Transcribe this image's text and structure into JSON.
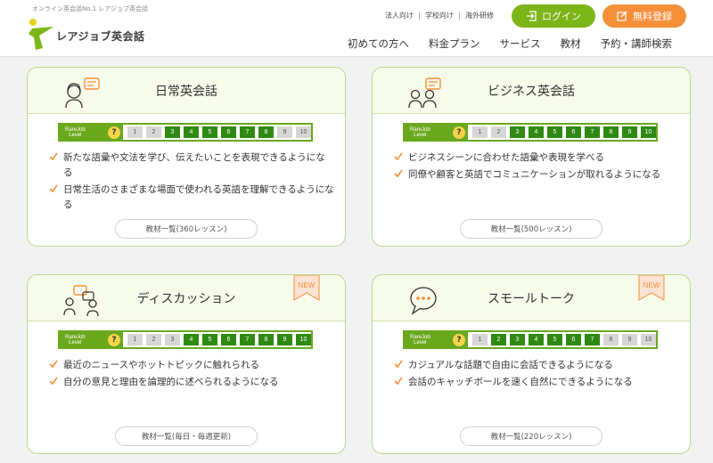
{
  "header": {
    "tagline": "オンライン英会話No.1 レアジョブ英会話",
    "logo_text": "レアジョブ英会話",
    "util_links": [
      "法人向け",
      "学校向け",
      "海外研修"
    ],
    "login_label": "ログイン",
    "signup_label": "無料登録",
    "nav": [
      "初めての方へ",
      "料金プラン",
      "サービス",
      "教材",
      "予約・講師検索"
    ]
  },
  "level_label": [
    "RareJob",
    "Level"
  ],
  "level_help": "?",
  "colors": {
    "accent": "#7cb518",
    "level_on": "#2f8a12",
    "level_off": "#d6d6d6",
    "signup": "#f58f3a"
  },
  "courses": [
    {
      "title": "日常英会話",
      "icon": "woman-speech-icon",
      "new": false,
      "level_range": [
        3,
        8
      ],
      "levels": [
        "1",
        "2",
        "3",
        "4",
        "5",
        "6",
        "7",
        "8",
        "9",
        "10"
      ],
      "bullets": [
        "新たな語彙や文法を学び、伝えたいことを表現できるようになる",
        "日常生活のさまざまな場面で使われる英語を理解できるようになる"
      ],
      "materials_label": "教材一覧(360レッスン)"
    },
    {
      "title": "ビジネス英会話",
      "icon": "business-people-icon",
      "new": false,
      "level_range": [
        3,
        10
      ],
      "levels": [
        "1",
        "2",
        "3",
        "4",
        "5",
        "6",
        "7",
        "8",
        "9",
        "10"
      ],
      "bullets": [
        "ビジネスシーンに合わせた語彙や表現を学べる",
        "同僚や顧客と英語でコミュニケーションが取れるようになる"
      ],
      "materials_label": "教材一覧(500レッスン)"
    },
    {
      "title": "ディスカッション",
      "icon": "discussion-people-icon",
      "new": true,
      "new_label": "NEW",
      "level_range": [
        4,
        10
      ],
      "levels": [
        "1",
        "2",
        "3",
        "4",
        "5",
        "6",
        "7",
        "8",
        "9",
        "10"
      ],
      "bullets": [
        "最近のニュースやホットトピックに触れられる",
        "自分の意見と理由を論理的に述べられるようになる"
      ],
      "materials_label": "教材一覧(毎日・毎週更新)"
    },
    {
      "title": "スモールトーク",
      "icon": "speech-bubble-icon",
      "new": true,
      "new_label": "NEW",
      "level_range": [
        2,
        7
      ],
      "levels": [
        "1",
        "2",
        "3",
        "4",
        "5",
        "6",
        "7",
        "8",
        "9",
        "10"
      ],
      "bullets": [
        "カジュアルな話題で自由に会話できるようになる",
        "会話のキャッチボールを速く自然にできるようになる"
      ],
      "materials_label": "教材一覧(220レッスン)"
    }
  ]
}
